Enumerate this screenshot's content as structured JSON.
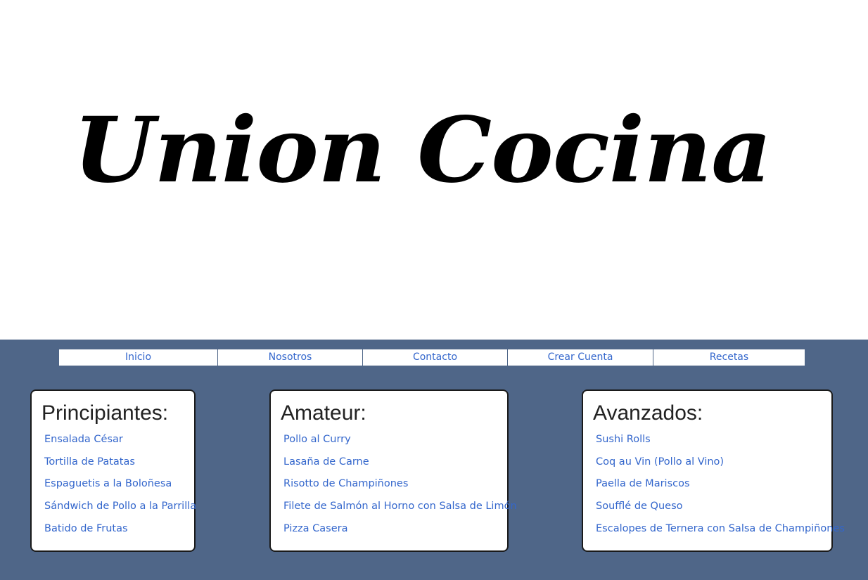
{
  "colors": {
    "band": "#4f6688",
    "link": "#3366cc",
    "heading": "#222222"
  },
  "logo": {
    "text": "Union Cocina"
  },
  "nav": {
    "items": [
      {
        "label": "Inicio"
      },
      {
        "label": "Nosotros"
      },
      {
        "label": "Contacto"
      },
      {
        "label": "Crear Cuenta"
      },
      {
        "label": "Recetas"
      }
    ]
  },
  "sections": [
    {
      "title": "Principiantes:",
      "recipes": [
        "Ensalada César",
        "Tortilla de Patatas",
        "Espaguetis a la Boloñesa",
        "Sándwich de Pollo a la Parrilla",
        "Batido de Frutas"
      ]
    },
    {
      "title": "Amateur:",
      "recipes": [
        "Pollo al Curry",
        "Lasaña de Carne",
        "Risotto de Champiñones",
        "Filete de Salmón al Horno con Salsa de Limón",
        "Pizza Casera"
      ]
    },
    {
      "title": "Avanzados:",
      "recipes": [
        "Sushi Rolls",
        "Coq au Vin (Pollo al Vino)",
        "Paella de Mariscos",
        "Soufflé de Queso",
        "Escalopes de Ternera con Salsa de Champiñones"
      ]
    }
  ]
}
